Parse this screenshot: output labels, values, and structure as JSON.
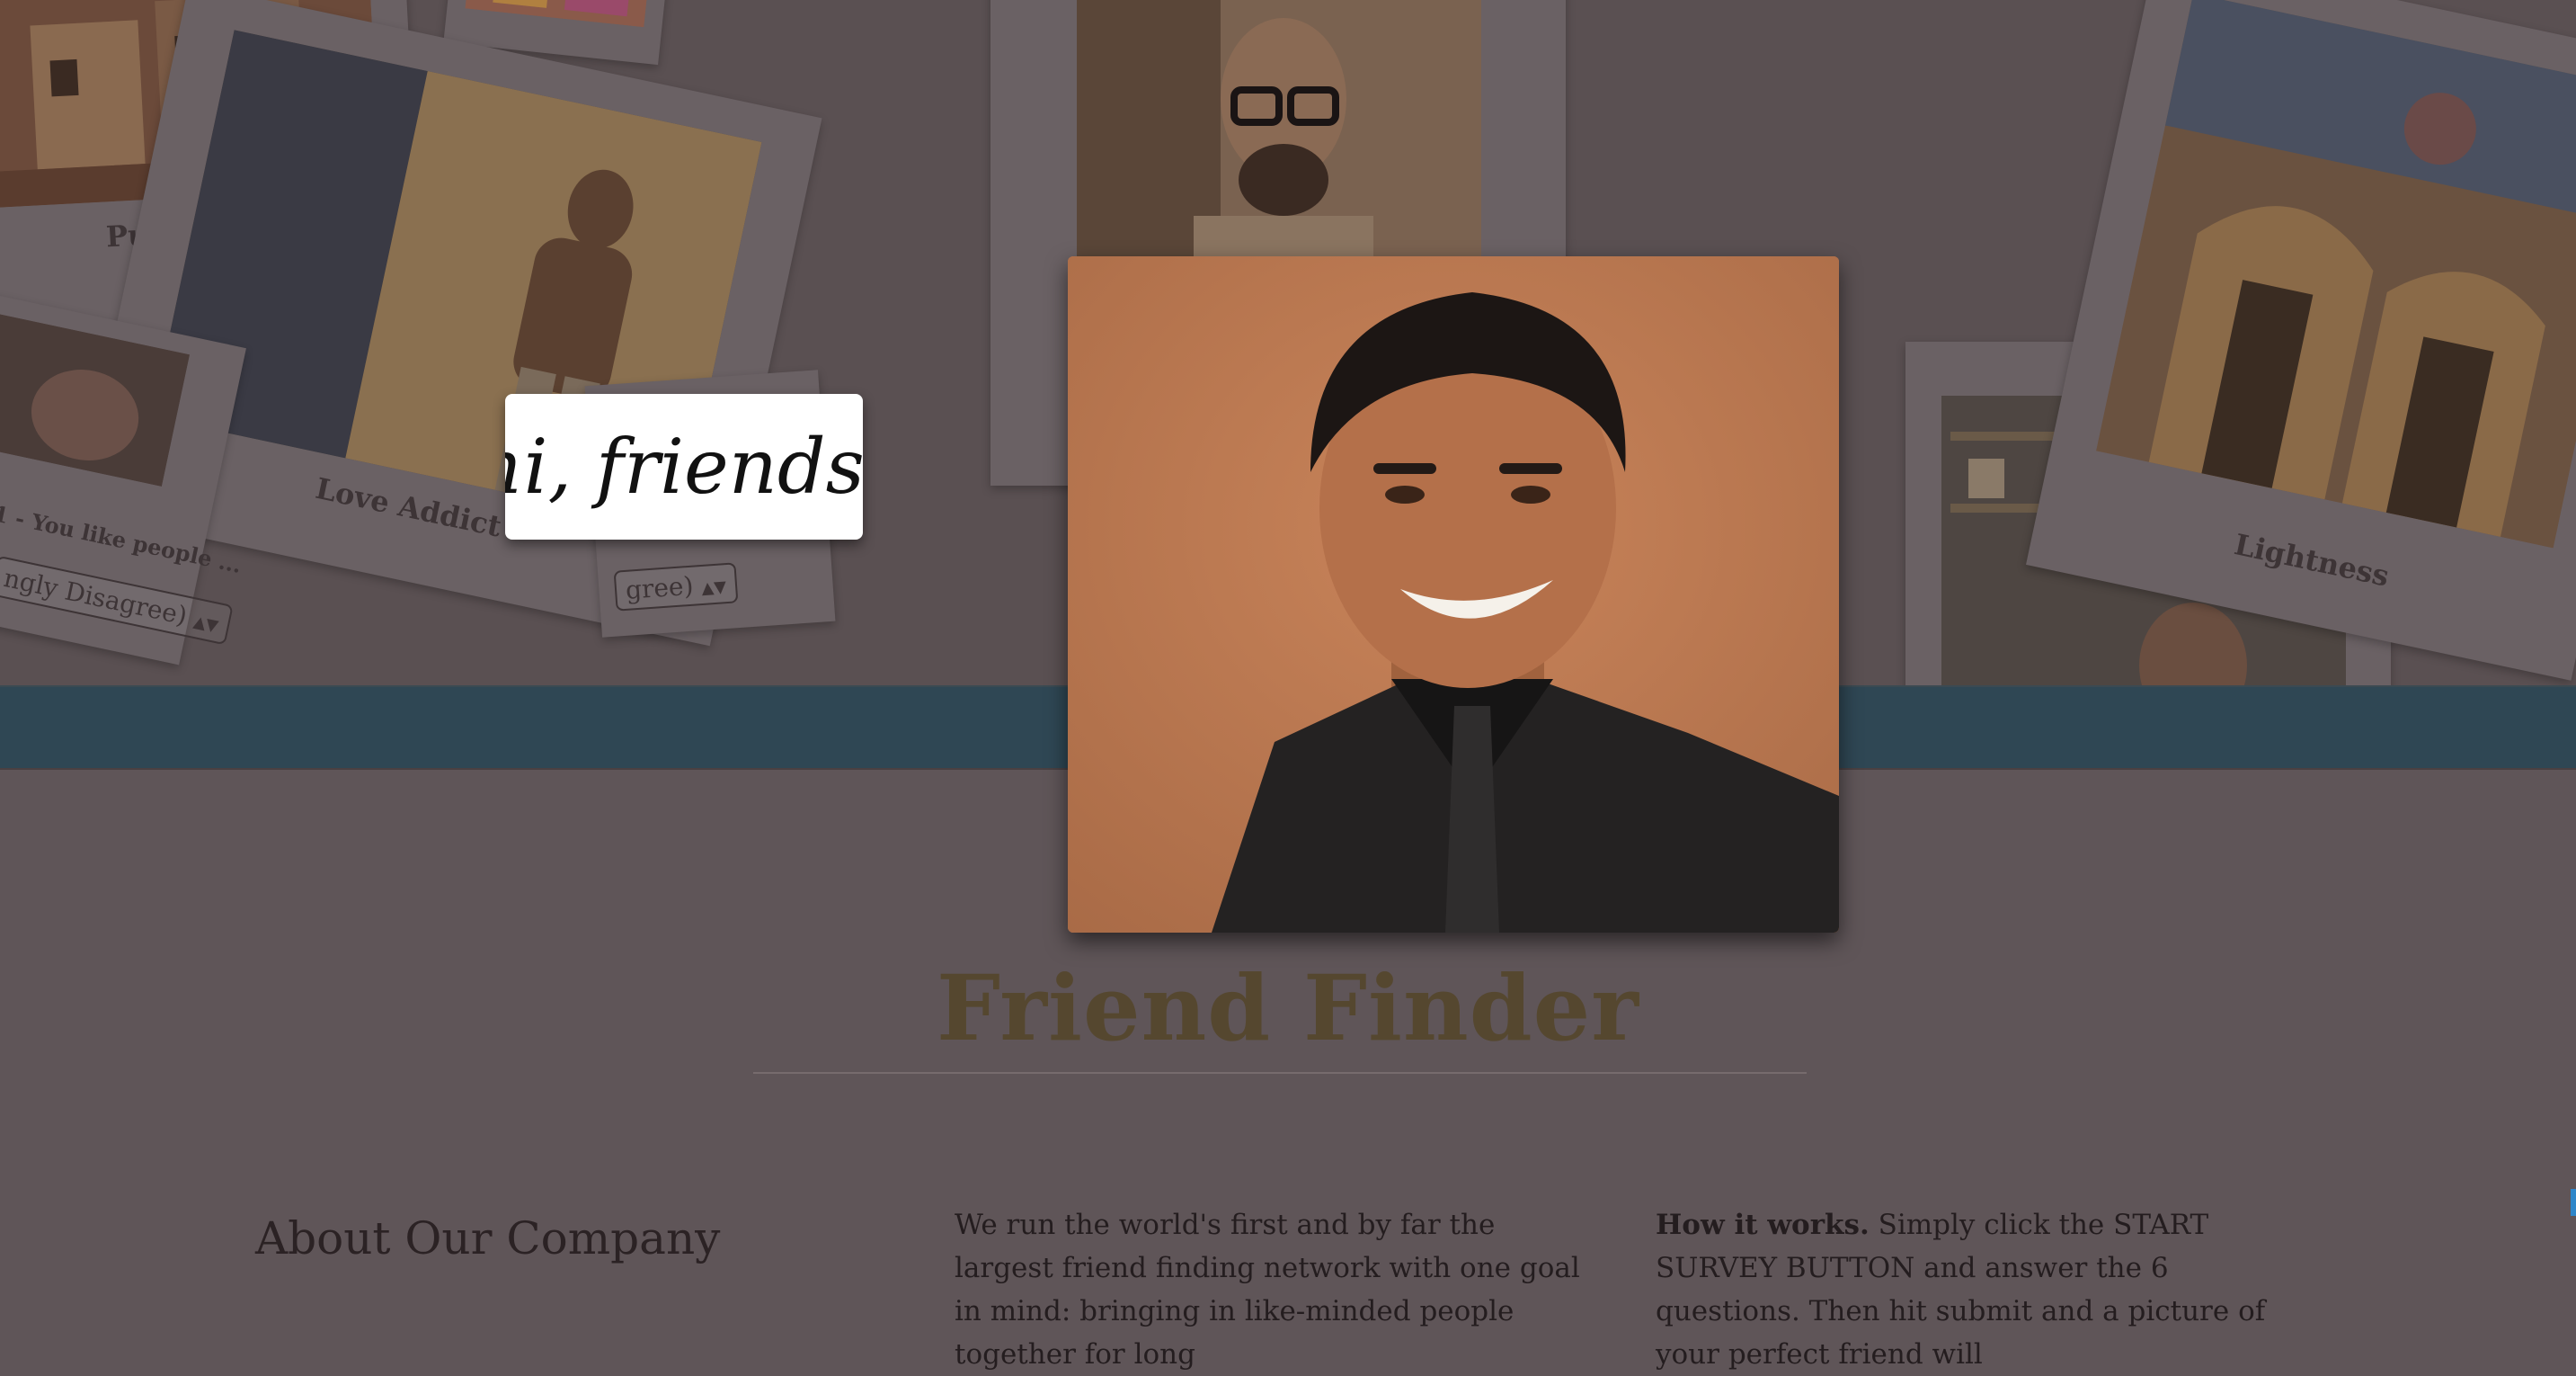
{
  "collage": {
    "captions": {
      "pure_soul": "Pure Soul",
      "love_addict": "Love Addict",
      "lightness": "Lightness"
    },
    "left_question_fragment": "1 - You like people ...",
    "left_select_value": "ngly Disagree)",
    "middle_select_value": "gree)"
  },
  "greeting_card": {
    "text": "hi, friends!"
  },
  "page": {
    "title": "Friend Finder",
    "about_heading": "About Our Company",
    "about_text": "We run the world's first and by far the largest friend finding network with one goal in mind: bringing in like-minded people together for long",
    "how_label": "How it works.",
    "how_text": " Simply click the START SURVEY BUTTON and answer the 6 questions. Then hit submit and a picture of your perfect friend will"
  },
  "colors": {
    "background": "#5f5558",
    "band": "#2f4754",
    "title": "#55472f",
    "portrait_backdrop": "#c07850"
  },
  "icons": {
    "select_arrows": "updown-arrows-icon"
  }
}
